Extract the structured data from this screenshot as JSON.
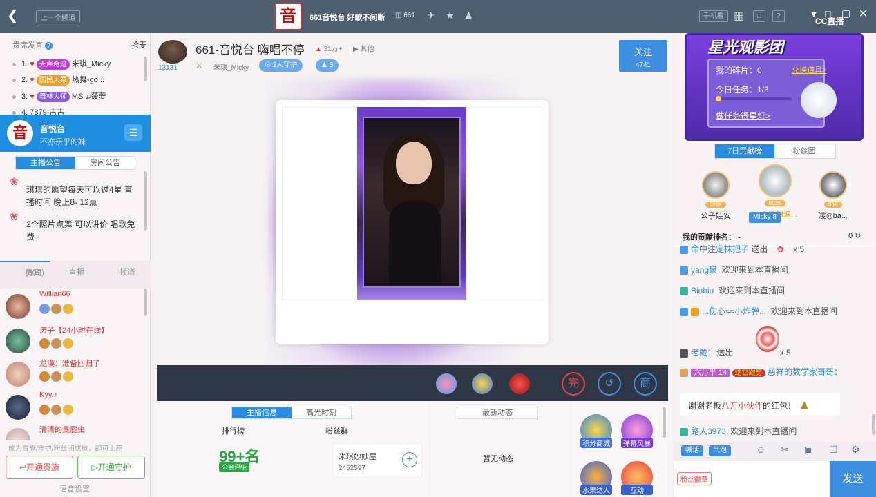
{
  "topbar": {
    "prev_channel": "上一个频道",
    "room_title": "661音悦台 好歌不间断",
    "room_id": "661",
    "room_logo": "音",
    "phone_view": "手机看",
    "brand": "CC直播"
  },
  "left": {
    "seat_header": "贵席发言",
    "grab": "抢麦",
    "ranks": [
      {
        "no": "1.",
        "badge": "天声奇迹",
        "name": "米琪_Micky",
        "badge_color": "#c03bd6"
      },
      {
        "no": "2.",
        "badge": "国民天粟",
        "name": "热舞-go...",
        "badge_color": "#f0a020"
      },
      {
        "no": "3.",
        "badge": "舞林大师",
        "name": "MS ♫菠萝",
        "badge_color": "#8a5ae0"
      },
      {
        "no": "4.",
        "badge": "",
        "name": "7879-古古",
        "badge_color": "#999999"
      }
    ],
    "streamer": {
      "logo": "音",
      "name": "音悦台",
      "subtitle": "不亦乐乎的妹"
    },
    "notice_tabs": [
      "主播公告",
      "房间公告"
    ],
    "notices": [
      "琪琪的愿望每天可以过4星 直播时间 晚上8- 12点",
      "2个照片点舞 可以讲价 唱歌免费"
    ],
    "user_tabs": {
      "nobles": "贵宾",
      "nobles_count": "(609)",
      "live": "直播",
      "channel": "频道"
    },
    "users": [
      {
        "name": "Willian66"
      },
      {
        "name": "涛子【24小时在线】"
      },
      {
        "name": "龙漠：准备回归了"
      },
      {
        "name": "Kyy.♪"
      },
      {
        "name": "清清的臭屁虫"
      }
    ],
    "join_hint": "成为贵族/守护/粉丝团成员，即可上座",
    "btn_noble": "开通贵族",
    "btn_guard": "开通守护",
    "voice_settings": "语音设置"
  },
  "center": {
    "anchor_id": "13131",
    "title": "661-音悦台 嗨唱不停",
    "heat": "31万+",
    "other": "其他",
    "owner": "米琪_Micky",
    "guards": "2人守护",
    "fans": "3",
    "follow_label": "关注",
    "follow_count": "4741",
    "info_tabs": [
      "主播信息",
      "高光时刻"
    ],
    "rank_label": "排行榜",
    "rank_value": "99+名",
    "guild_label": "公会评级",
    "fan_group_label": "粉丝群",
    "fan_group_name": "米琪妙妙屋",
    "fan_group_id": "2452597",
    "news_tab": "最新动态",
    "no_news": "暂无动态",
    "games": [
      "积分商城",
      "弹幕风暴",
      "水果达人",
      "互动"
    ]
  },
  "right": {
    "banner_title": "星光观影团",
    "my_fragments": "我的碎片：0",
    "redeem": "兑换道具>",
    "today_task": "今日任务：1/3",
    "do_task": "做任务得星灯>",
    "rank_tabs": [
      "7日贡献榜",
      "粉丝团"
    ],
    "top3": [
      {
        "name": "公子娃安",
        "score": "101K"
      },
      {
        "name": "一个还想追...",
        "score": "502K"
      },
      {
        "name": "凌◎ba...",
        "score": "86K"
      }
    ],
    "micky_tag": "Micky 8",
    "my_rank_label": "我的贡献排名：",
    "my_rank_value": "-",
    "my_rank_count": "0",
    "chats": [
      {
        "user": "命中注定抹把子",
        "text": "送出",
        "extra": "x 5"
      },
      {
        "user": "yang泉",
        "text": "欢迎来到本直播间",
        "extra": ""
      },
      {
        "user": "Biubiu",
        "text": "欢迎来到本直播间",
        "extra": ""
      },
      {
        "user": "...伤心≈≈小炸弹...",
        "text": "欢迎来到本直播间",
        "extra": ""
      },
      {
        "user": "老戴1",
        "text": "送出",
        "extra": "x 5"
      },
      {
        "user": "六月半 14",
        "text": "慈祥的数学家哥哥：",
        "extra": ""
      },
      {
        "user": "路人3973",
        "text": "欢迎来到本直播间",
        "extra": ""
      }
    ],
    "world_tag": "绝世跟男",
    "red_packet_pre": "谢谢老板",
    "red_packet_user": "八万小伙伴",
    "red_packet_post": "的红包！",
    "chip1": "喊话",
    "chip2": "气泡",
    "fan_light": "粉丝徽章",
    "send": "发送"
  }
}
